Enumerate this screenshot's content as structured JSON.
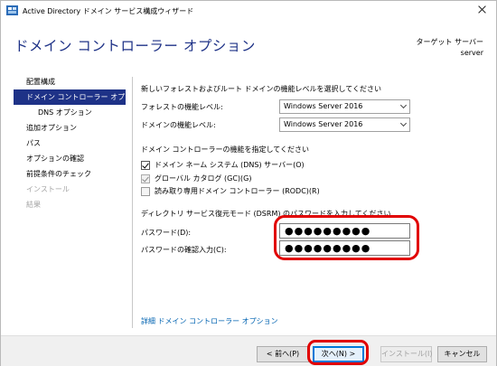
{
  "window": {
    "title": "Active Directory ドメイン サービス構成ウィザード"
  },
  "header": {
    "page_title": "ドメイン コントローラー オプション",
    "target_label": "ターゲット サーバー",
    "target_value": "server"
  },
  "nav": {
    "items": [
      {
        "label": "配置構成",
        "state": "normal"
      },
      {
        "label": "ドメイン コントローラー オプ...",
        "state": "active"
      },
      {
        "label": "DNS オプション",
        "state": "sub"
      },
      {
        "label": "追加オプション",
        "state": "normal"
      },
      {
        "label": "パス",
        "state": "normal"
      },
      {
        "label": "オプションの確認",
        "state": "normal"
      },
      {
        "label": "前提条件のチェック",
        "state": "normal"
      },
      {
        "label": "インストール",
        "state": "disabled"
      },
      {
        "label": "結果",
        "state": "disabled"
      }
    ]
  },
  "form": {
    "functional_level_heading": "新しいフォレストおよびルート ドメインの機能レベルを選択してください",
    "forest_level_label": "フォレストの機能レベル:",
    "forest_level_value": "Windows Server 2016",
    "domain_level_label": "ドメインの機能レベル:",
    "domain_level_value": "Windows Server 2016",
    "capabilities_heading": "ドメイン コントローラーの機能を指定してください",
    "dns_server_label": "ドメイン ネーム システム (DNS) サーバー(O)",
    "global_catalog_label": "グローバル カタログ (GC)(G)",
    "rodc_label": "読み取り専用ドメイン コントローラー (RODC)(R)",
    "dsrm_heading": "ディレクトリ サービス復元モード (DSRM) のパスワードを入力してください",
    "password_label": "パスワード(D):",
    "password_value": "●●●●●●●●●",
    "confirm_label": "パスワードの確認入力(C):",
    "confirm_value": "●●●●●●●●●"
  },
  "link": {
    "details_label": "詳細 ドメイン コントローラー オプション"
  },
  "footer": {
    "back_label": "< 前へ(P)",
    "next_label": "次へ(N) >",
    "install_label": "インストール(I)",
    "cancel_label": "キャンセル"
  },
  "colors": {
    "accent": "#1e3287",
    "highlight": "#e10000",
    "link": "#0063b1"
  }
}
